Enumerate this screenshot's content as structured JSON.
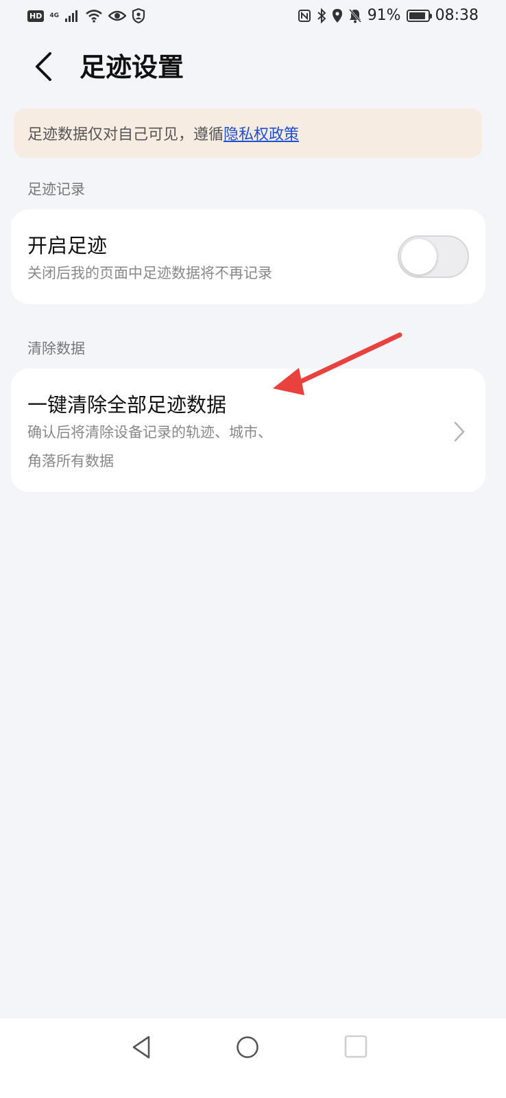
{
  "status_bar": {
    "hd": "HD",
    "network": "4G",
    "battery_percent": "91%",
    "battery_level": 0.91,
    "time": "08:38"
  },
  "header": {
    "title": "足迹设置"
  },
  "notice": {
    "text": "足迹数据仅对自己可见，遵循",
    "link_text": "隐私权政策",
    "link_color": "#1d4fd6"
  },
  "sections": {
    "record": {
      "label": "足迹记录",
      "item": {
        "title": "开启足迹",
        "subtitle": "关闭后我的页面中足迹数据将不再记录",
        "toggle_on": false
      }
    },
    "clear": {
      "label": "清除数据",
      "item": {
        "title": "一键清除全部足迹数据",
        "subtitle_line1": "确认后将清除设备记录的轨迹、城市、",
        "subtitle_line2": "角落所有数据"
      }
    }
  },
  "annotation": {
    "arrow_color": "#e8413e"
  },
  "nav_bar": {
    "back_icon": "triangle-back-icon",
    "home_icon": "circle-home-icon",
    "recent_icon": "square-recent-icon"
  }
}
